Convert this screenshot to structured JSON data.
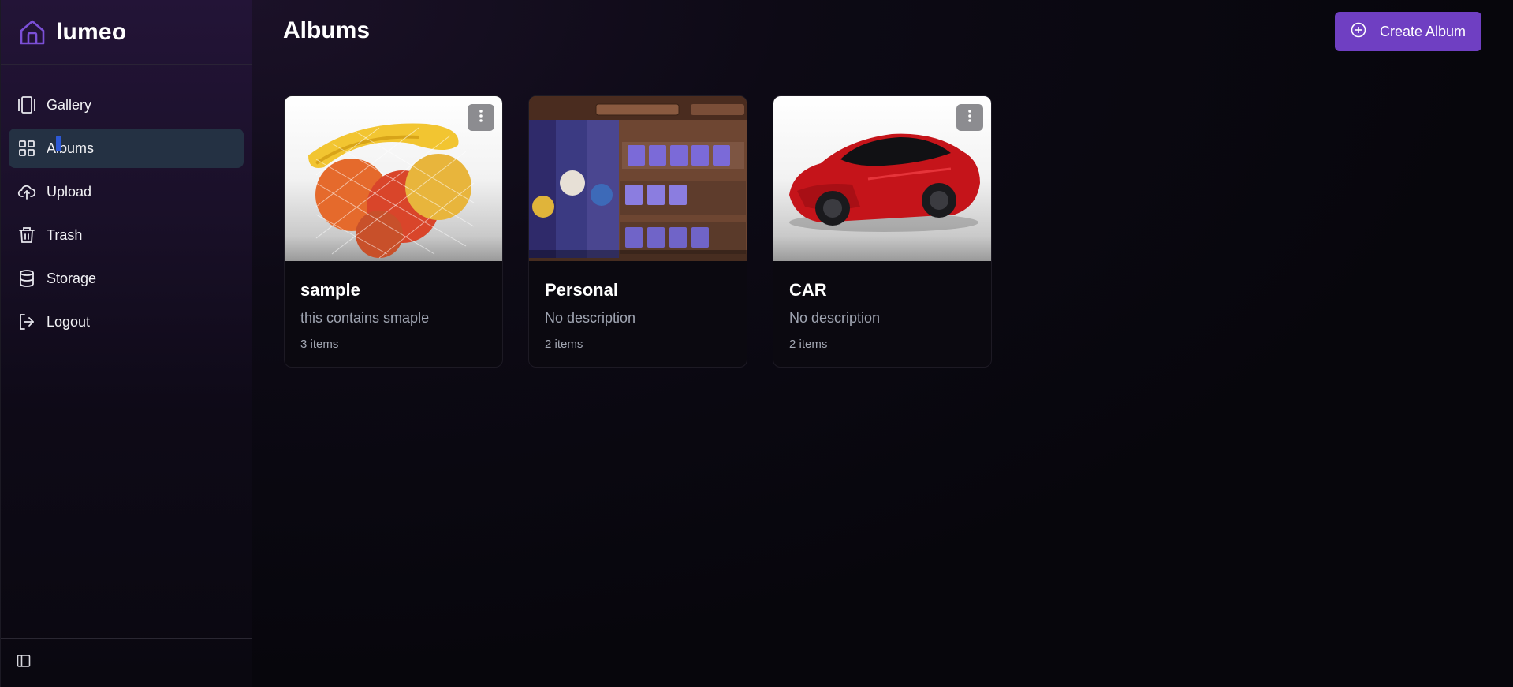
{
  "app": {
    "name": "lumeo"
  },
  "sidebar": {
    "items": [
      {
        "label": "Gallery",
        "icon": "gallery-icon",
        "active": false
      },
      {
        "label": "Albums",
        "icon": "grid-icon",
        "active": true
      },
      {
        "label": "Upload",
        "icon": "cloud-upload-icon",
        "active": false
      },
      {
        "label": "Trash",
        "icon": "trash-icon",
        "active": false
      },
      {
        "label": "Storage",
        "icon": "database-icon",
        "active": false
      },
      {
        "label": "Logout",
        "icon": "logout-icon",
        "active": false
      }
    ],
    "footer_icon": "sidebar-toggle-icon"
  },
  "header": {
    "title": "Albums",
    "create_label": "Create Album"
  },
  "albums": [
    {
      "title": "sample",
      "description": "this contains smaple",
      "count": "3 items",
      "thumbnail": "fruit-net-bag"
    },
    {
      "title": "Personal",
      "description": "No description",
      "count": "2 items",
      "thumbnail": "game-screenshot"
    },
    {
      "title": "CAR",
      "description": "No description",
      "count": "2 items",
      "thumbnail": "red-sports-car"
    }
  ],
  "colors": {
    "accent": "#6f3fc2",
    "active_nav": "#243143",
    "background": "#0a0710",
    "muted_text": "#a0a5b2"
  }
}
